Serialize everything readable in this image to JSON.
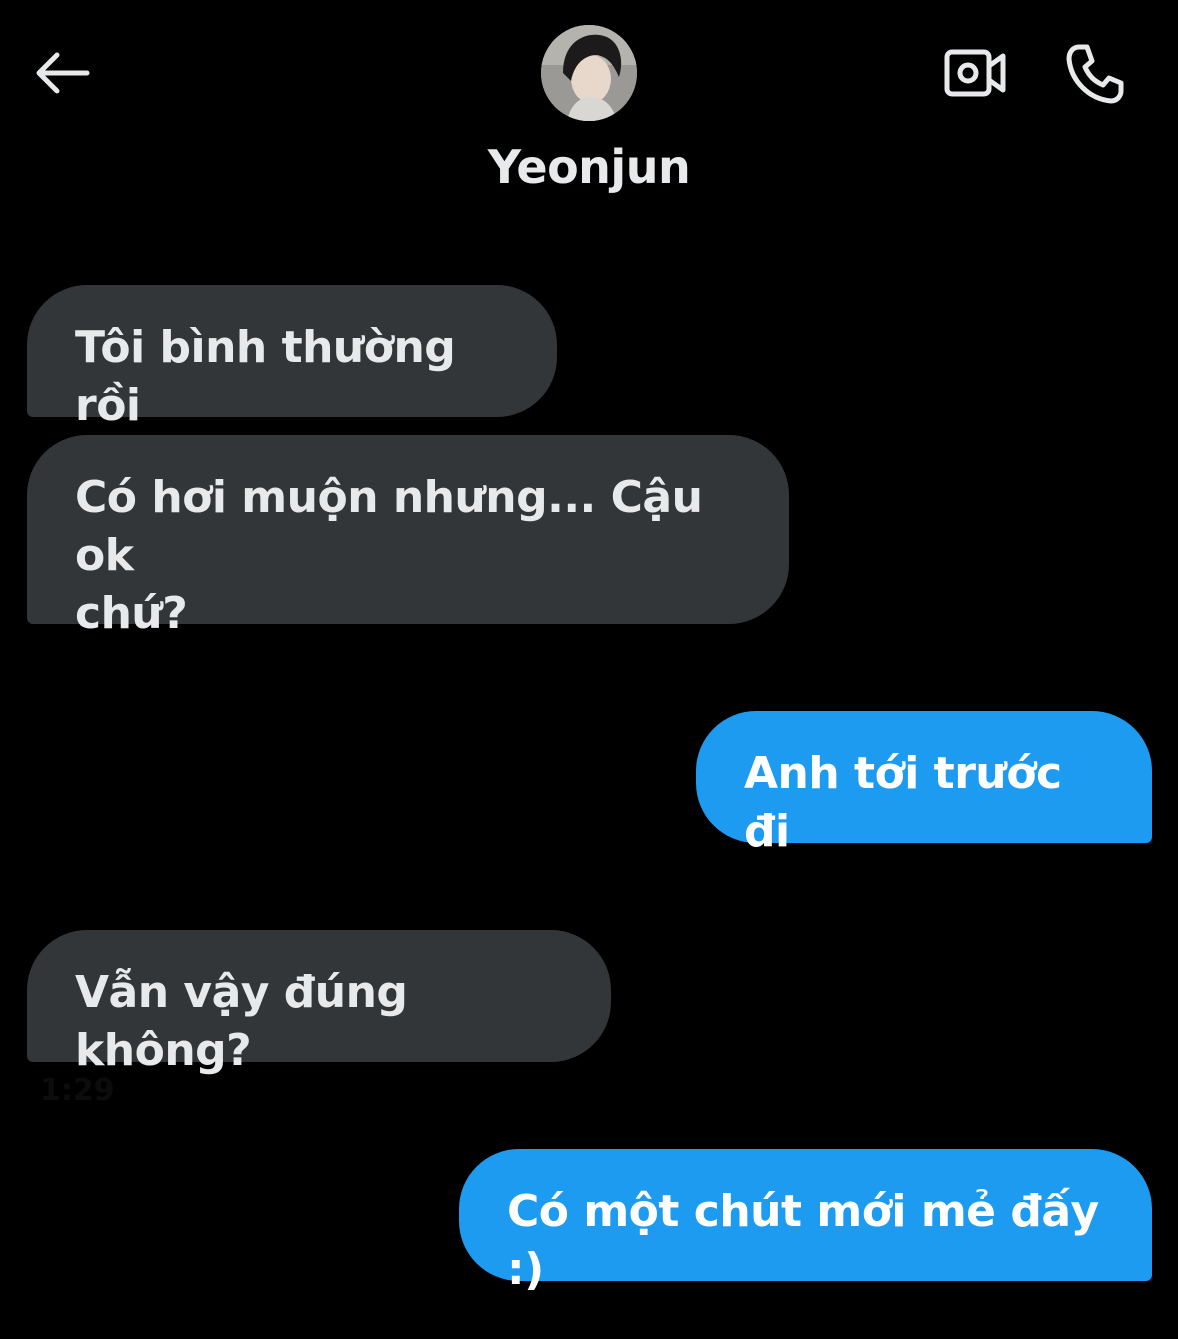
{
  "header": {
    "contact_name": "Yeonjun"
  },
  "icons": {
    "back": "arrow-left-icon",
    "video": "video-camera-icon",
    "call": "phone-icon"
  },
  "colors": {
    "background": "#000000",
    "incoming_bubble": "#333639",
    "outgoing_bubble": "#1d9bf0",
    "text": "#e7e9ea"
  },
  "messages": [
    {
      "direction": "incoming",
      "text": "Tôi bình thường rồi"
    },
    {
      "direction": "incoming",
      "text": "Có hơi muộn nhưng... Cậu ok\nchứ?"
    },
    {
      "direction": "outgoing",
      "text": "Anh tới trước đi"
    },
    {
      "direction": "incoming",
      "text": "Vẫn vậy đúng không?"
    },
    {
      "direction": "outgoing",
      "text": "Có một chút mới mẻ đấy :)"
    }
  ],
  "timestamps": [
    "1:29"
  ]
}
